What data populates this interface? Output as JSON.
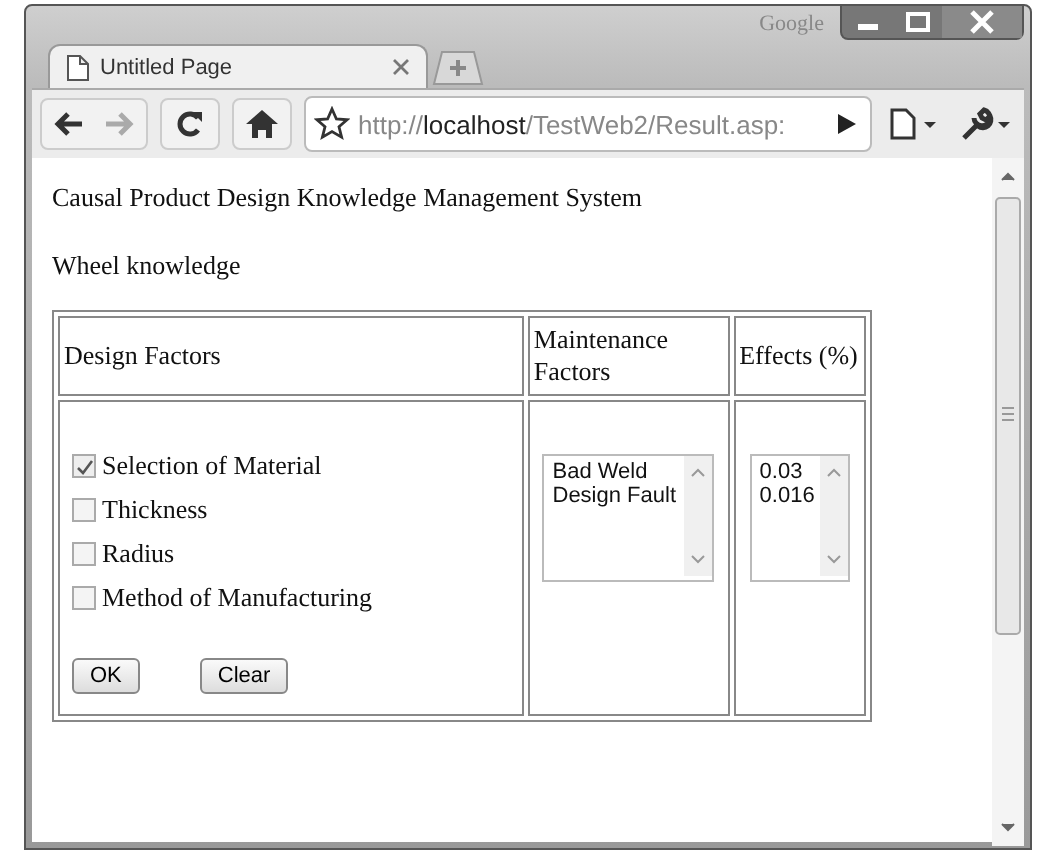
{
  "browser": {
    "brand": "Google"
  },
  "tabs": [
    {
      "title": "Untitled Page",
      "selected": true
    }
  ],
  "address": {
    "scheme": "http://",
    "host": "localhost",
    "path": "/TestWeb2/Result.asp:"
  },
  "page": {
    "title": "Causal Product Design Knowledge Management System",
    "subtitle": "Wheel knowledge",
    "columns": [
      "Design Factors",
      "Maintenance Factors",
      "Effects (%)"
    ],
    "design_factors": [
      {
        "label": "Selection of Material",
        "checked": true
      },
      {
        "label": "Thickness",
        "checked": false
      },
      {
        "label": "Radius",
        "checked": false
      },
      {
        "label": "Method of Manufacturing",
        "checked": false
      }
    ],
    "buttons": [
      "OK",
      "Clear"
    ],
    "maintenance_factors": [
      "Bad Weld",
      "Design Fault"
    ],
    "effects": [
      "0.03",
      "0.016"
    ]
  }
}
